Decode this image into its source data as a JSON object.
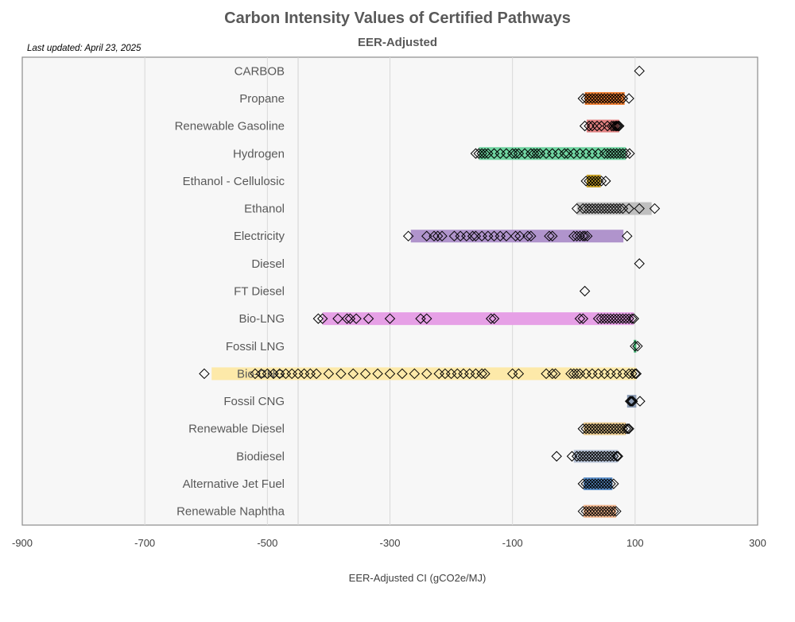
{
  "chart_data": {
    "type": "scatter",
    "title": "Carbon Intensity Values of Certified Pathways",
    "subtitle": "EER-Adjusted",
    "annotation": "Last updated: April 23, 2025",
    "xlabel": "EER-Adjusted CI (gCO2e/MJ)",
    "ylabel": "",
    "xlim": [
      -900,
      300
    ],
    "xticks": [
      -900,
      -700,
      -500,
      -300,
      -100,
      100,
      300
    ],
    "xtick_labels": [
      "-900",
      "-700",
      "-500",
      "-300",
      "-100",
      "100",
      "300"
    ],
    "grid": "vertical",
    "legend": "none",
    "marker": "open-diamond",
    "categories": [
      {
        "name": "CARBOB",
        "color": "#c8c8c8",
        "range": null,
        "points": [
          107
        ]
      },
      {
        "name": "Propane",
        "color": "#ed7d31",
        "range": [
          18,
          83
        ],
        "points": [
          15,
          20,
          25,
          30,
          35,
          40,
          45,
          50,
          55,
          60,
          65,
          70,
          75,
          80,
          90
        ]
      },
      {
        "name": "Renewable Gasoline",
        "color": "#e08080",
        "range": [
          21,
          74
        ],
        "points": [
          18,
          25,
          30,
          38,
          45,
          55,
          62,
          65,
          68,
          70,
          72,
          74
        ]
      },
      {
        "name": "Hydrogen",
        "color": "#6fd3a0",
        "range": [
          -155,
          85
        ],
        "points": [
          -160,
          -155,
          -150,
          -145,
          -140,
          -130,
          -120,
          -110,
          -100,
          -95,
          -90,
          -80,
          -70,
          -65,
          -60,
          -55,
          -45,
          -35,
          -25,
          -15,
          -10,
          0,
          10,
          20,
          30,
          40,
          50,
          55,
          60,
          65,
          70,
          75,
          80,
          85,
          91
        ]
      },
      {
        "name": "Ethanol - Cellulosic",
        "color": "#c9a227",
        "range": [
          21,
          44
        ],
        "points": [
          20,
          25,
          30,
          35,
          40,
          45,
          52
        ]
      },
      {
        "name": "Ethanol",
        "color": "#bfbfbf",
        "range": [
          5,
          127
        ],
        "points": [
          5,
          15,
          20,
          25,
          30,
          35,
          40,
          45,
          50,
          55,
          60,
          65,
          70,
          75,
          80,
          90,
          107,
          132
        ]
      },
      {
        "name": "Electricity",
        "color": "#b094cc",
        "range": [
          -266,
          81
        ],
        "points": [
          -270,
          -240,
          -228,
          -222,
          -215,
          -195,
          -185,
          -175,
          -165,
          -160,
          -150,
          -140,
          -130,
          -120,
          -110,
          -95,
          -88,
          -75,
          -70,
          -40,
          -35,
          0,
          5,
          10,
          15,
          18,
          22,
          87
        ]
      },
      {
        "name": "Diesel",
        "color": "#c8c8c8",
        "range": null,
        "points": [
          107
        ]
      },
      {
        "name": "FT Diesel",
        "color": "#c8c8c8",
        "range": null,
        "points": [
          18
        ]
      },
      {
        "name": "Bio-LNG",
        "color": "#e6a0e6",
        "range": [
          -410,
          98
        ],
        "points": [
          -417,
          -410,
          -385,
          -370,
          -365,
          -355,
          -335,
          -300,
          -250,
          -240,
          -135,
          -130,
          10,
          15,
          40,
          45,
          50,
          55,
          60,
          65,
          70,
          75,
          80,
          85,
          90,
          95,
          98
        ]
      },
      {
        "name": "Fossil LNG",
        "color": "#3cb371",
        "range": [
          98,
          102
        ],
        "points": [
          100,
          104
        ]
      },
      {
        "name": "Bio-CNG",
        "color": "#fde9a9",
        "range": [
          -591,
          102
        ],
        "points": [
          -603,
          -520,
          -510,
          -500,
          -490,
          -480,
          -470,
          -460,
          -450,
          -440,
          -430,
          -420,
          -400,
          -380,
          -360,
          -340,
          -320,
          -300,
          -280,
          -260,
          -240,
          -220,
          -210,
          -200,
          -190,
          -180,
          -170,
          -160,
          -150,
          -145,
          -100,
          -90,
          -45,
          -35,
          -30,
          -5,
          0,
          5,
          10,
          20,
          30,
          40,
          50,
          60,
          70,
          80,
          90,
          95,
          100,
          102
        ]
      },
      {
        "name": "Fossil CNG",
        "color": "#8c9cb4",
        "range": [
          87,
          102
        ],
        "points": [
          92,
          94,
          96,
          108
        ]
      },
      {
        "name": "Renewable Diesel",
        "color": "#e8c98f",
        "range": [
          16,
          85
        ],
        "points": [
          15,
          20,
          25,
          30,
          35,
          40,
          45,
          50,
          55,
          60,
          65,
          70,
          75,
          80,
          85,
          88,
          90
        ]
      },
      {
        "name": "Biodiesel",
        "color": "#b4c0d4",
        "range": [
          0,
          72
        ],
        "points": [
          -28,
          -3,
          5,
          10,
          15,
          20,
          25,
          30,
          35,
          40,
          45,
          50,
          55,
          60,
          65,
          70,
          72
        ]
      },
      {
        "name": "Alternative Jet Fuel",
        "color": "#5b8fc9",
        "range": [
          16,
          63
        ],
        "points": [
          15,
          20,
          25,
          30,
          35,
          40,
          45,
          50,
          55,
          60,
          65
        ]
      },
      {
        "name": "Renewable Naphtha",
        "color": "#f0b48c",
        "range": [
          16,
          69
        ],
        "points": [
          15,
          20,
          25,
          30,
          35,
          40,
          45,
          50,
          55,
          60,
          65,
          69
        ]
      }
    ]
  }
}
